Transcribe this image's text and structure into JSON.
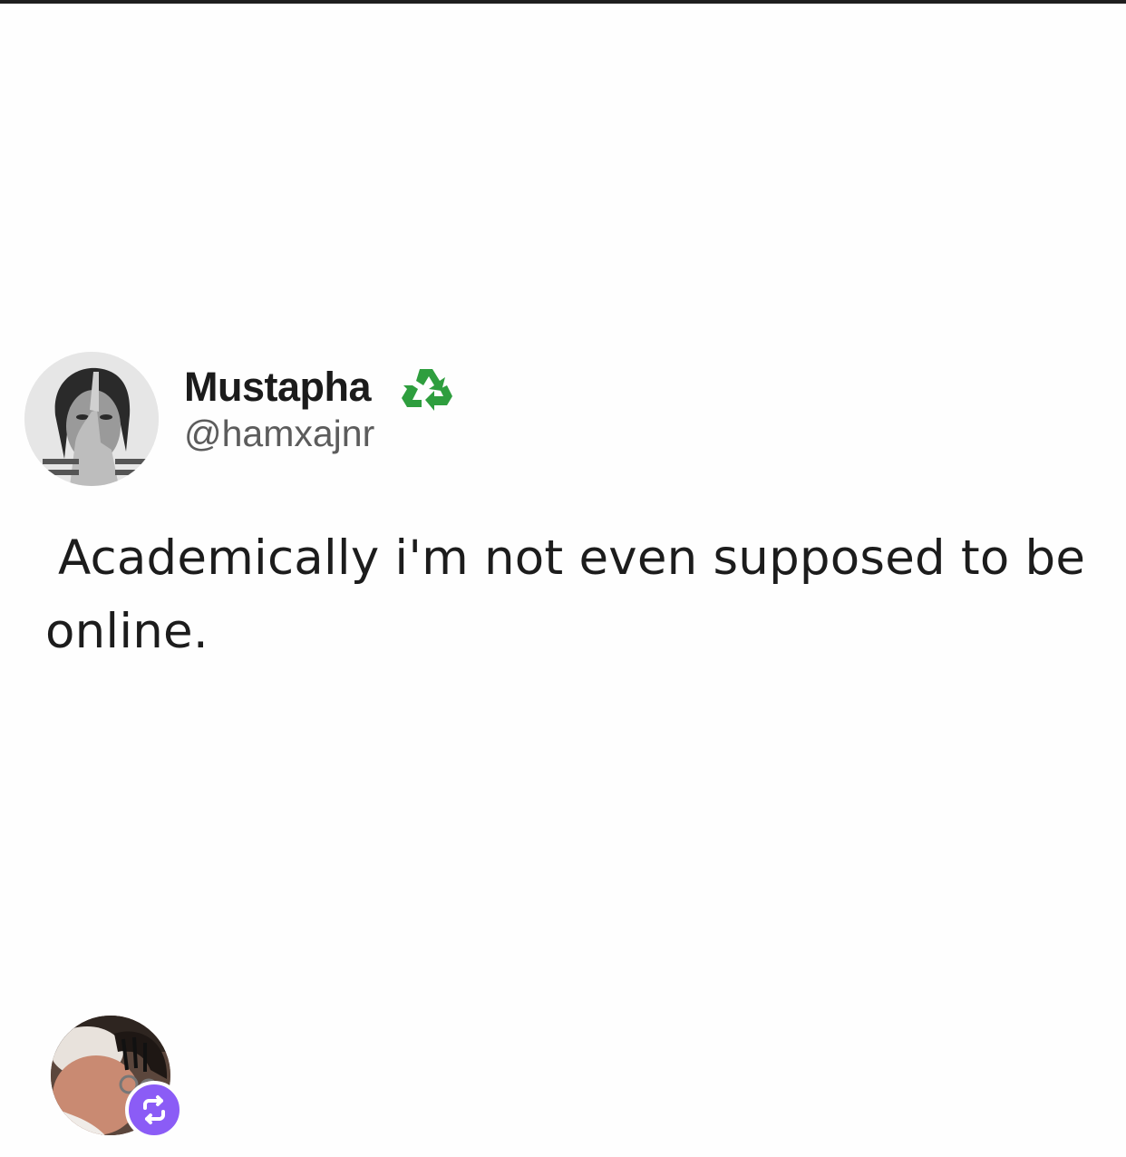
{
  "tweet": {
    "author_name": "Mustapha",
    "author_handle": "@hamxajnr",
    "badge_icon": "recycle-icon",
    "badge_color": "#2e9e3e",
    "text": "Academically i'm not even supposed to be online."
  },
  "reposter": {
    "avatar": "reposter-avatar",
    "badge_icon": "repost-icon",
    "badge_color": "#8b5cf6"
  }
}
